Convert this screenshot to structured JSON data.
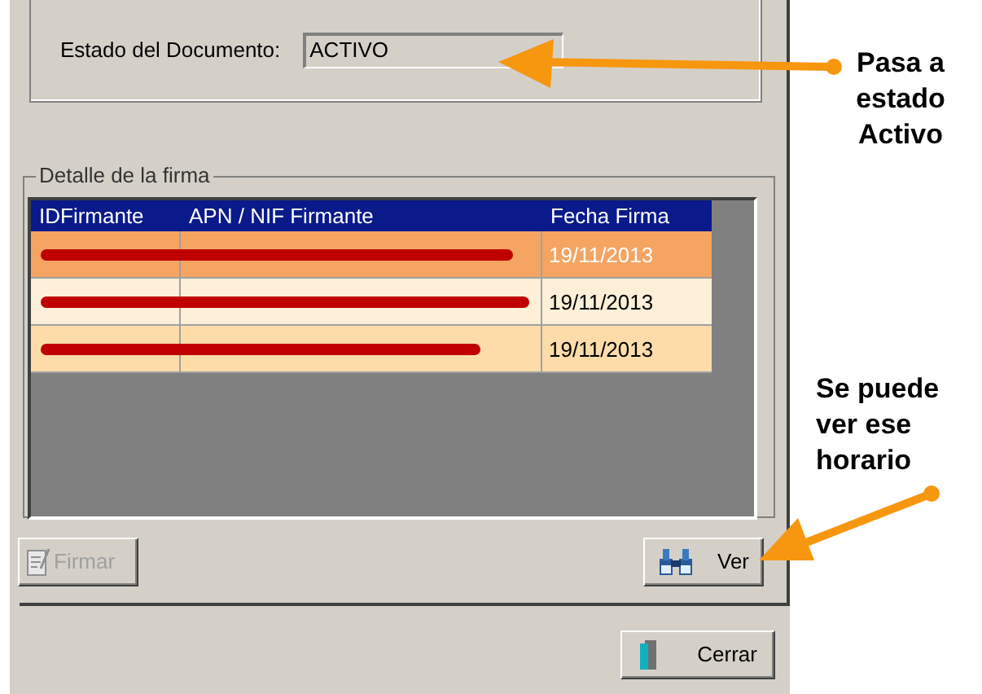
{
  "status_field": {
    "label": "Estado del Documento:",
    "value": "ACTIVO"
  },
  "signature_group": {
    "title": "Detalle de la firma",
    "table": {
      "columns": [
        "IDFirmante",
        "APN / NIF Firmante",
        "Fecha Firma"
      ],
      "rows": [
        {
          "selected": true,
          "redacted": true,
          "date": "19/11/2013"
        },
        {
          "selected": false,
          "redacted": true,
          "date": "19/11/2013"
        },
        {
          "selected": false,
          "redacted": true,
          "date": "19/11/2013"
        }
      ]
    },
    "buttons": [
      {
        "label": "Firmar",
        "kind": "sign",
        "disabled": true
      },
      {
        "label": "Ver",
        "kind": "view",
        "disabled": false
      }
    ]
  },
  "close_button": {
    "label": "Cerrar"
  },
  "annotations": [
    {
      "lines": [
        "Pasa a",
        "estado",
        "Activo"
      ]
    },
    {
      "lines": [
        "Se puede",
        "ver ese",
        "horario"
      ]
    }
  ]
}
